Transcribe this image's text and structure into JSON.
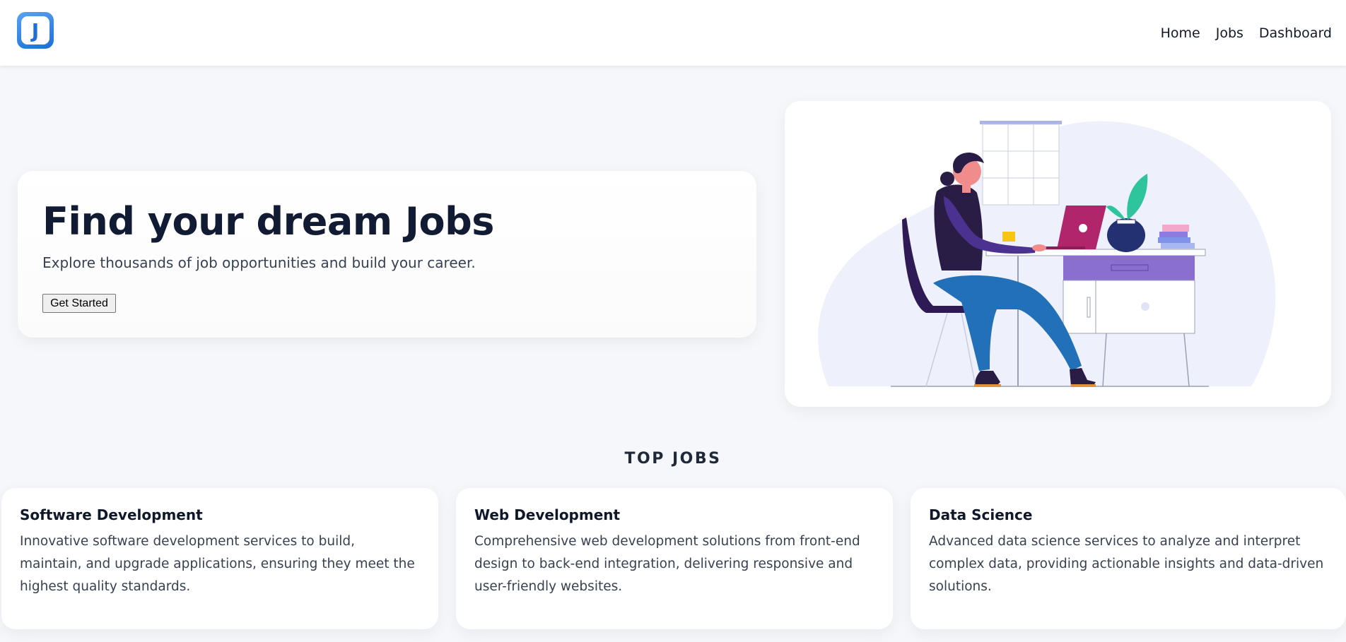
{
  "header": {
    "logo_letter": "J",
    "nav": [
      {
        "label": "Home"
      },
      {
        "label": "Jobs"
      },
      {
        "label": "Dashboard"
      }
    ]
  },
  "hero": {
    "title": "Find your dream Jobs",
    "subtitle": "Explore thousands of job opportunities and build your career.",
    "button_label": "Get Started",
    "illustration_icon": "woman-working-at-desk-illustration"
  },
  "top_jobs": {
    "heading": "TOP JOBS",
    "cards": [
      {
        "title": "Software Development",
        "description": "Innovative software development services to build, maintain, and upgrade applications, ensuring they meet the highest quality standards."
      },
      {
        "title": "Web Development",
        "description": "Comprehensive web development solutions from front-end design to back-end integration, delivering responsive and user-friendly websites."
      },
      {
        "title": "Data Science",
        "description": "Advanced data science services to analyze and interpret complex data, providing actionable insights and data-driven solutions."
      }
    ]
  },
  "colors": {
    "background": "#f6f7fb",
    "accent_blue": "#1d6ed8",
    "laptop": "#b0256b",
    "drawer": "#8b6fd0",
    "pants": "#2170b8"
  }
}
